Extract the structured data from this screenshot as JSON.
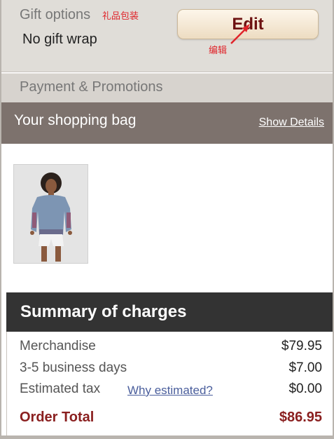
{
  "gift": {
    "title": "Gift options",
    "annotation_cn": "礼品包装",
    "value": "No gift wrap",
    "edit_label": "Edit",
    "edit_annotation_cn": "编辑"
  },
  "payment": {
    "label": "Payment & Promotions"
  },
  "bag": {
    "title": "Your shopping bag",
    "show_details": "Show Details"
  },
  "summary": {
    "title": "Summary of charges",
    "merchandise_label": "Merchandise",
    "merchandise_amount": "$79.95",
    "shipping_label": "3-5 business days",
    "shipping_amount": "$7.00",
    "tax_label": "Estimated tax",
    "tax_link": "Why estimated?",
    "tax_amount": "$0.00",
    "total_label": "Order Total",
    "total_amount": "$86.95"
  },
  "colors": {
    "accent": "#8a1f1f",
    "annotation": "#e0242a",
    "bag_header": "#7d726d",
    "summary_header": "#333333"
  }
}
